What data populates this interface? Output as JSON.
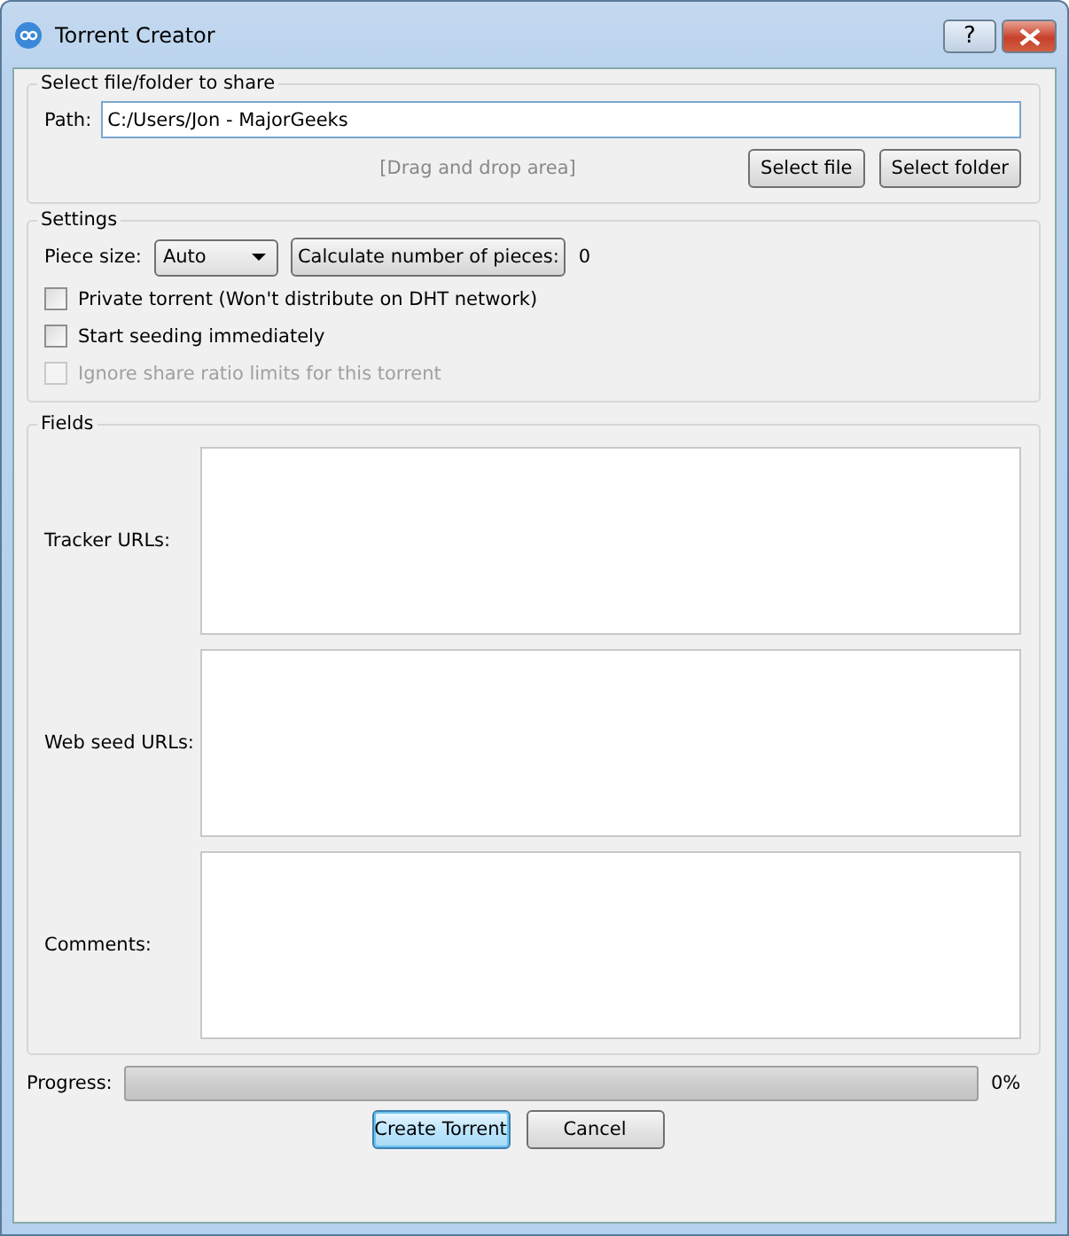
{
  "window": {
    "title": "Torrent Creator",
    "controls": [
      {
        "kind": "help",
        "label": "?"
      },
      {
        "kind": "close"
      }
    ]
  },
  "source": {
    "title": "Select file/folder to share",
    "path_label": "Path:",
    "path": "C:/Users/Jon - MajorGeeks",
    "drop_hint": "[Drag and drop area]",
    "buttons": [
      "Select file",
      "Select folder"
    ]
  },
  "settings": {
    "title": "Settings",
    "piece_size_label": "Piece size:",
    "piece_size": "Auto",
    "calculate_button": "Calculate number of pieces:",
    "piece_count": "0",
    "options": [
      {
        "label": "Private torrent (Won't distribute on DHT network)",
        "checked": false,
        "disabled": false
      },
      {
        "label": "Start seeding immediately",
        "checked": false,
        "disabled": false
      },
      {
        "label": "Ignore share ratio limits for this torrent",
        "checked": false,
        "disabled": true
      }
    ]
  },
  "fields": {
    "title": "Fields",
    "items": [
      {
        "label": "Tracker URLs:"
      },
      {
        "label": "Web seed URLs:"
      },
      {
        "label": "Comments:"
      }
    ]
  },
  "progress": {
    "label": "Progress:",
    "level": 0,
    "reading": "0%"
  },
  "buttons": [
    {
      "label": "Create Torrent",
      "default": true
    },
    {
      "label": "Cancel",
      "default": false
    }
  ]
}
